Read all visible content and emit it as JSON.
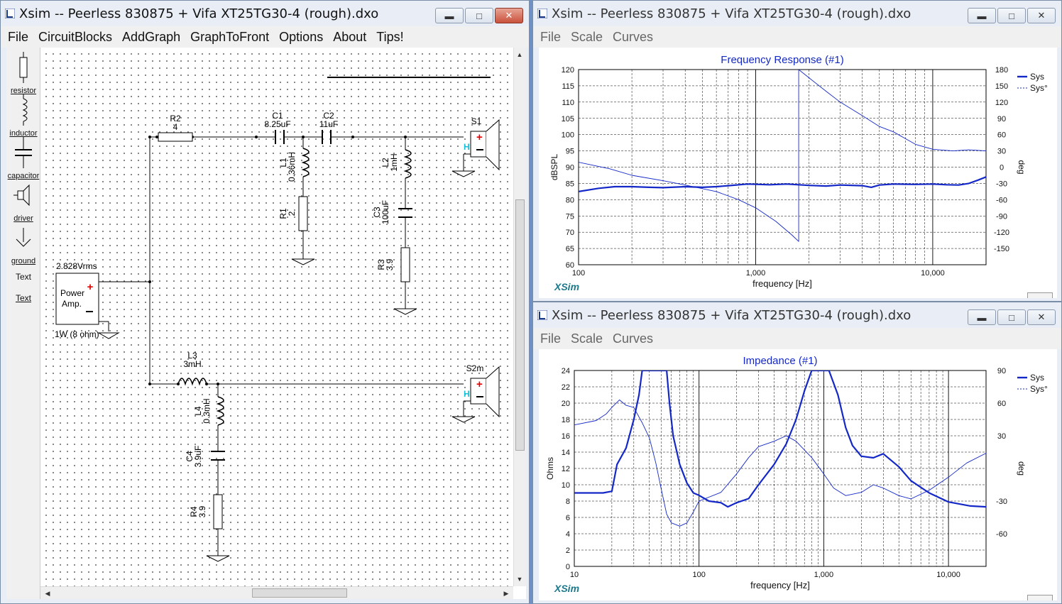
{
  "schematic_window": {
    "title": "Xsim -- Peerless 830875 + Vifa XT25TG30-4 (rough).dxo",
    "menu": [
      "File",
      "CircuitBlocks",
      "AddGraph",
      "GraphToFront",
      "Options",
      "About",
      "Tips!"
    ],
    "palette": [
      "resistor",
      "inductor",
      "capacitor",
      "driver",
      "ground",
      "Text",
      "Text"
    ],
    "source": {
      "voltage": "2.828Vrms",
      "label1": "Power",
      "label2": "Amp.",
      "power": "1W (8 ohm)"
    },
    "components": {
      "R2": {
        "name": "R2",
        "value": "4"
      },
      "C1": {
        "name": "C1",
        "value": "8.25uF"
      },
      "C2": {
        "name": "C2",
        "value": "11uF"
      },
      "L1": {
        "name": "L1",
        "value": "0.36mH"
      },
      "R1": {
        "name": "R1",
        "value": "2"
      },
      "L2": {
        "name": "L2",
        "value": "1mH"
      },
      "C3": {
        "name": "C3",
        "value": "100uF"
      },
      "R3": {
        "name": "R3",
        "value": "3.9"
      },
      "L3": {
        "name": "L3",
        "value": "3mH"
      },
      "L4": {
        "name": "L4",
        "value": "0.3mH"
      },
      "C4": {
        "name": "C4",
        "value": "3.9uF"
      },
      "R4": {
        "name": "R4",
        "value": "3.9"
      },
      "S1": {
        "name": "S1"
      },
      "S2m": {
        "name": "S2m"
      }
    }
  },
  "freq_window": {
    "title": "Xsim -- Peerless 830875 + Vifa XT25TG30-4 (rough).dxo",
    "menu": [
      "File",
      "Scale",
      "Curves"
    ],
    "watermark": "XSim"
  },
  "imp_window": {
    "title": "Xsim -- Peerless 830875 + Vifa XT25TG30-4 (rough).dxo",
    "menu": [
      "File",
      "Scale",
      "Curves"
    ],
    "watermark": "XSim"
  },
  "chart_data": [
    {
      "type": "line",
      "title": "Frequency Response (#1)",
      "xlabel": "frequency [Hz]",
      "ylabel": "dBSPL",
      "y2label": "deg",
      "xscale": "log",
      "xlim": [
        100,
        20000
      ],
      "ylim": [
        60,
        120
      ],
      "y2lim": [
        -180,
        180
      ],
      "xticks": [
        "100",
        "1,000",
        "10,000"
      ],
      "yticks": [
        "60",
        "65",
        "70",
        "75",
        "80",
        "85",
        "90",
        "95",
        "100",
        "105",
        "110",
        "115",
        "120"
      ],
      "y2ticks": [
        "-150",
        "-120",
        "-90",
        "-60",
        "-30",
        "0",
        "30",
        "60",
        "90",
        "120",
        "150",
        "180"
      ],
      "grid": true,
      "legend": "top-right",
      "series": [
        {
          "name": "Sys",
          "axis": "left",
          "style": "solid-bold",
          "color": "#1428c8",
          "points": [
            [
              100,
              82.5
            ],
            [
              130,
              83.5
            ],
            [
              160,
              84
            ],
            [
              200,
              84
            ],
            [
              250,
              83.8
            ],
            [
              300,
              83.7
            ],
            [
              400,
              84
            ],
            [
              500,
              83.8
            ],
            [
              600,
              84
            ],
            [
              700,
              84.3
            ],
            [
              900,
              84.8
            ],
            [
              1200,
              84.6
            ],
            [
              1500,
              84.8
            ],
            [
              2000,
              84.4
            ],
            [
              2500,
              84.2
            ],
            [
              3000,
              84.5
            ],
            [
              4000,
              84.3
            ],
            [
              4500,
              83.8
            ],
            [
              5000,
              84.5
            ],
            [
              6000,
              84.8
            ],
            [
              8000,
              84.7
            ],
            [
              10000,
              84.8
            ],
            [
              12000,
              84.6
            ],
            [
              14000,
              84.5
            ],
            [
              16000,
              85
            ],
            [
              18000,
              86
            ],
            [
              20000,
              87
            ]
          ]
        },
        {
          "name": "Sys°",
          "axis": "right",
          "style": "thin",
          "color": "#1428c8",
          "points": [
            [
              100,
              9
            ],
            [
              150,
              -3
            ],
            [
              200,
              -15
            ],
            [
              300,
              -25
            ],
            [
              400,
              -33
            ],
            [
              600,
              -45
            ],
            [
              800,
              -60
            ],
            [
              1000,
              -75
            ],
            [
              1300,
              -100
            ],
            [
              1600,
              -125
            ],
            [
              1750,
              -137
            ],
            [
              1750,
              180
            ],
            [
              2000,
              165
            ],
            [
              2500,
              140
            ],
            [
              3000,
              120
            ],
            [
              4000,
              95
            ],
            [
              5000,
              75
            ],
            [
              6000,
              65
            ],
            [
              8000,
              42
            ],
            [
              10000,
              33
            ],
            [
              13000,
              30
            ],
            [
              16000,
              32
            ],
            [
              20000,
              30
            ]
          ]
        }
      ]
    },
    {
      "type": "line",
      "title": "Impedance (#1)",
      "xlabel": "frequency [Hz]",
      "ylabel": "Ohms",
      "y2label": "deg",
      "xscale": "log",
      "xlim": [
        10,
        20000
      ],
      "ylim": [
        0,
        24
      ],
      "y2lim": [
        -90,
        90
      ],
      "xticks": [
        "10",
        "100",
        "1,000",
        "10,000"
      ],
      "yticks": [
        "0",
        "2",
        "4",
        "6",
        "8",
        "10",
        "12",
        "14",
        "16",
        "18",
        "20",
        "22",
        "24"
      ],
      "y2ticks": [
        "-60",
        "-30",
        "30",
        "60",
        "90"
      ],
      "grid": true,
      "legend": "top-right",
      "series": [
        {
          "name": "Sys",
          "axis": "left",
          "style": "solid-bold",
          "color": "#1428c8",
          "points": [
            [
              10,
              9
            ],
            [
              17,
              9
            ],
            [
              20,
              9.2
            ],
            [
              22,
              12.5
            ],
            [
              26,
              14.5
            ],
            [
              30,
              18
            ],
            [
              33,
              21
            ],
            [
              35,
              24
            ],
            [
              55,
              24
            ],
            [
              58,
              20
            ],
            [
              62,
              16
            ],
            [
              70,
              12.5
            ],
            [
              80,
              10.2
            ],
            [
              90,
              9
            ],
            [
              100,
              8.7
            ],
            [
              120,
              8
            ],
            [
              150,
              7.8
            ],
            [
              170,
              7.3
            ],
            [
              200,
              7.8
            ],
            [
              250,
              8.3
            ],
            [
              300,
              10
            ],
            [
              400,
              12.5
            ],
            [
              500,
              15
            ],
            [
              600,
              18
            ],
            [
              700,
              21.5
            ],
            [
              800,
              24
            ],
            [
              1100,
              24
            ],
            [
              1300,
              21
            ],
            [
              1500,
              17
            ],
            [
              1700,
              14.8
            ],
            [
              2000,
              13.5
            ],
            [
              2500,
              13.3
            ],
            [
              3000,
              13.8
            ],
            [
              4000,
              12.2
            ],
            [
              5000,
              10.5
            ],
            [
              7000,
              9
            ],
            [
              10000,
              7.9
            ],
            [
              15000,
              7.4
            ],
            [
              20000,
              7.3
            ]
          ]
        },
        {
          "name": "Sys°",
          "axis": "right",
          "style": "thin",
          "color": "#1428c8",
          "points": [
            [
              10,
              40
            ],
            [
              15,
              44
            ],
            [
              18,
              50
            ],
            [
              20,
              56
            ],
            [
              23,
              63
            ],
            [
              26,
              58
            ],
            [
              30,
              56
            ],
            [
              35,
              42
            ],
            [
              40,
              28
            ],
            [
              45,
              5
            ],
            [
              50,
              -20
            ],
            [
              55,
              -42
            ],
            [
              60,
              -50
            ],
            [
              70,
              -53
            ],
            [
              80,
              -50
            ],
            [
              90,
              -40
            ],
            [
              100,
              -30
            ],
            [
              150,
              -22
            ],
            [
              200,
              -5
            ],
            [
              250,
              10
            ],
            [
              300,
              20
            ],
            [
              400,
              25
            ],
            [
              500,
              30
            ],
            [
              600,
              25
            ],
            [
              800,
              10
            ],
            [
              1000,
              -5
            ],
            [
              1200,
              -18
            ],
            [
              1500,
              -25
            ],
            [
              2000,
              -22
            ],
            [
              2500,
              -15
            ],
            [
              3000,
              -18
            ],
            [
              4000,
              -25
            ],
            [
              5000,
              -28
            ],
            [
              7000,
              -20
            ],
            [
              10000,
              -8
            ],
            [
              14000,
              5
            ],
            [
              20000,
              14
            ]
          ]
        }
      ]
    }
  ]
}
